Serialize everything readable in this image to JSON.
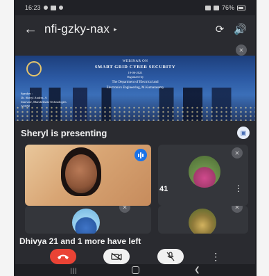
{
  "status_bar": {
    "time": "16:23",
    "battery": "76%"
  },
  "header": {
    "meeting_code": "nfi-gzky-nax",
    "icons": [
      "back-arrow-icon",
      "switch-camera-icon",
      "speaker-icon"
    ]
  },
  "slide": {
    "line1": "WEBINAR ON",
    "line2": "SMART GRID CYBER SECURITY",
    "line3": "19-06-2021",
    "line4": "Organized by",
    "line5": "The Department of Electrical and",
    "line6": "Electronics Engineering, M.Kumarasamy",
    "speaker_label": "Speaker :",
    "speaker_name": "Dr. Sheryl Andres. A",
    "speaker_org": "Innovate, Marubethala Technologies",
    "speaker_extra": "ACEW"
  },
  "presenting": {
    "label": "Sheryl is presenting"
  },
  "tiles": {
    "extra_count": "41"
  },
  "notification": {
    "left_message": "Dhivya 21 and 1 more have left"
  },
  "colors": {
    "background": "#2a2b30",
    "end_call": "#ea4335",
    "speaking": "#1a73e8"
  }
}
